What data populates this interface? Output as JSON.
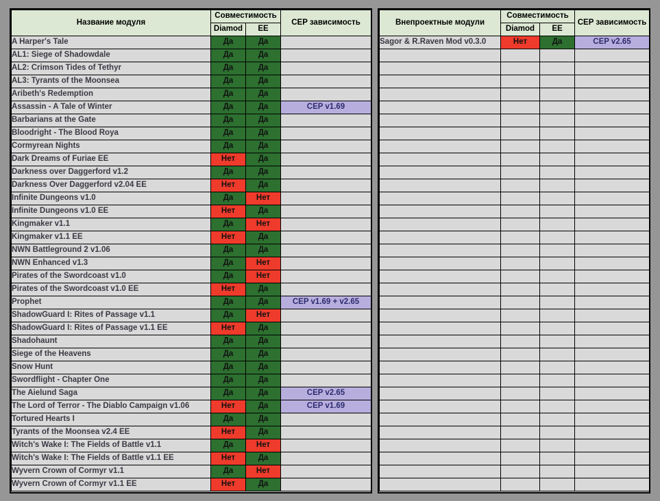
{
  "page": {
    "background_color": "#969696",
    "colors": {
      "header_bg": "#dce8d3",
      "row_bg": "#d9d9d9",
      "yes_bg": "#2d7030",
      "no_bg": "#ee3b2b",
      "dependency_bg": "#b8aede",
      "dependency_text": "#2b2b6e",
      "name_text": "#3a3a44",
      "border": "#000000"
    }
  },
  "left_table": {
    "headers": {
      "name": "Название модуля",
      "compatibility": "Совместимость",
      "diamond": "Diamod",
      "ee": "EE",
      "dependency": "CEP зависимость"
    },
    "values": {
      "yes": "Да",
      "no": "Нет"
    },
    "rows": [
      {
        "name": "A Harper's Tale",
        "diamond": "Да",
        "ee": "Да",
        "dependency": ""
      },
      {
        "name": "AL1: Siege of Shadowdale",
        "diamond": "Да",
        "ee": "Да",
        "dependency": ""
      },
      {
        "name": "AL2: Crimson Tides of Tethyr",
        "diamond": "Да",
        "ee": "Да",
        "dependency": ""
      },
      {
        "name": "AL3: Tyrants of the Moonsea",
        "diamond": "Да",
        "ee": "Да",
        "dependency": ""
      },
      {
        "name": "Aribeth's Redemption",
        "diamond": "Да",
        "ee": "Да",
        "dependency": ""
      },
      {
        "name": "Assassin - A Tale of Winter",
        "diamond": "Да",
        "ee": "Да",
        "dependency": "CEP v1.69"
      },
      {
        "name": "Barbarians at the Gate",
        "diamond": "Да",
        "ee": "Да",
        "dependency": ""
      },
      {
        "name": "Bloodright - The Blood Roya",
        "diamond": "Да",
        "ee": "Да",
        "dependency": ""
      },
      {
        "name": "Cormyrean Nights",
        "diamond": "Да",
        "ee": "Да",
        "dependency": ""
      },
      {
        "name": "Dark Dreams of Furiae EE",
        "diamond": "Нет",
        "ee": "Да",
        "dependency": ""
      },
      {
        "name": "Darkness over Daggerford v1.2",
        "diamond": "Да",
        "ee": "Да",
        "dependency": ""
      },
      {
        "name": "Darkness Over Daggerford v2.04 EE",
        "diamond": "Нет",
        "ee": "Да",
        "dependency": ""
      },
      {
        "name": "Infinite Dungeons v1.0",
        "diamond": "Да",
        "ee": "Нет",
        "dependency": ""
      },
      {
        "name": "Infinite Dungeons v1.0 EE",
        "diamond": "Нет",
        "ee": "Да",
        "dependency": ""
      },
      {
        "name": "Kingmaker v1.1",
        "diamond": "Да",
        "ee": "Нет",
        "dependency": ""
      },
      {
        "name": "Kingmaker v1.1 EE",
        "diamond": "Нет",
        "ee": "Да",
        "dependency": ""
      },
      {
        "name": "NWN Battleground 2 v1.06",
        "diamond": "Да",
        "ee": "Да",
        "dependency": ""
      },
      {
        "name": "NWN Enhanced v1.3",
        "diamond": "Да",
        "ee": "Нет",
        "dependency": ""
      },
      {
        "name": "Pirates of the Swordcoast v1.0",
        "diamond": "Да",
        "ee": "Нет",
        "dependency": ""
      },
      {
        "name": "Pirates of the Swordcoast v1.0 EE",
        "diamond": "Нет",
        "ee": "Да",
        "dependency": ""
      },
      {
        "name": "Prophet",
        "diamond": "Да",
        "ee": "Да",
        "dependency": "CEP v1.69 + v2.65"
      },
      {
        "name": "ShadowGuard I: Rites of Passage v1.1",
        "diamond": "Да",
        "ee": "Нет",
        "dependency": ""
      },
      {
        "name": "ShadowGuard I: Rites of Passage v1.1 EE",
        "diamond": "Нет",
        "ee": "Да",
        "dependency": ""
      },
      {
        "name": "Shadohaunt",
        "diamond": "Да",
        "ee": "Да",
        "dependency": ""
      },
      {
        "name": "Siege of the Heavens",
        "diamond": "Да",
        "ee": "Да",
        "dependency": ""
      },
      {
        "name": "Snow Hunt",
        "diamond": "Да",
        "ee": "Да",
        "dependency": ""
      },
      {
        "name": "Swordflight - Chapter One",
        "diamond": "Да",
        "ee": "Да",
        "dependency": ""
      },
      {
        "name": "The Aielund Saga",
        "diamond": "Да",
        "ee": "Да",
        "dependency": "CEP v2.65"
      },
      {
        "name": "The Lord of Terror - The Diablo Campaign v1.06",
        "diamond": "Нет",
        "ee": "Да",
        "dependency": "CEP v1.69"
      },
      {
        "name": "Tortured Hearts I",
        "diamond": "Да",
        "ee": "Да",
        "dependency": ""
      },
      {
        "name": "Tyrants of the Moonsea v2.4 EE",
        "diamond": "Нет",
        "ee": "Да",
        "dependency": ""
      },
      {
        "name": "Witch's Wake I: The Fields of Battle v1.1",
        "diamond": "Да",
        "ee": "Нет",
        "dependency": ""
      },
      {
        "name": "Witch's Wake I: The Fields of Battle v1.1 EE",
        "diamond": "Нет",
        "ee": "Да",
        "dependency": ""
      },
      {
        "name": "Wyvern Crown of Cormyr v1.1",
        "diamond": "Да",
        "ee": "Нет",
        "dependency": ""
      },
      {
        "name": "Wyvern Crown of Cormyr v1.1 EE",
        "diamond": "Нет",
        "ee": "Да",
        "dependency": ""
      }
    ]
  },
  "right_table": {
    "headers": {
      "name": "Внепроектные модули",
      "compatibility": "Совместимость",
      "diamond": "Diamod",
      "ee": "EE",
      "dependency": "CEP зависимость"
    },
    "rows": [
      {
        "name": "Sagor & R.Raven Mod v0.3.0",
        "diamond": "Нет",
        "ee": "Да",
        "dependency": "CEP v2.65"
      },
      {
        "name": "",
        "diamond": "",
        "ee": "",
        "dependency": ""
      },
      {
        "name": "",
        "diamond": "",
        "ee": "",
        "dependency": ""
      },
      {
        "name": "",
        "diamond": "",
        "ee": "",
        "dependency": ""
      },
      {
        "name": "",
        "diamond": "",
        "ee": "",
        "dependency": ""
      },
      {
        "name": "",
        "diamond": "",
        "ee": "",
        "dependency": ""
      },
      {
        "name": "",
        "diamond": "",
        "ee": "",
        "dependency": ""
      },
      {
        "name": "",
        "diamond": "",
        "ee": "",
        "dependency": ""
      },
      {
        "name": "",
        "diamond": "",
        "ee": "",
        "dependency": ""
      },
      {
        "name": "",
        "diamond": "",
        "ee": "",
        "dependency": ""
      },
      {
        "name": "",
        "diamond": "",
        "ee": "",
        "dependency": ""
      },
      {
        "name": "",
        "diamond": "",
        "ee": "",
        "dependency": ""
      },
      {
        "name": "",
        "diamond": "",
        "ee": "",
        "dependency": ""
      },
      {
        "name": "",
        "diamond": "",
        "ee": "",
        "dependency": ""
      },
      {
        "name": "",
        "diamond": "",
        "ee": "",
        "dependency": ""
      },
      {
        "name": "",
        "diamond": "",
        "ee": "",
        "dependency": ""
      },
      {
        "name": "",
        "diamond": "",
        "ee": "",
        "dependency": ""
      },
      {
        "name": "",
        "diamond": "",
        "ee": "",
        "dependency": ""
      },
      {
        "name": "",
        "diamond": "",
        "ee": "",
        "dependency": ""
      },
      {
        "name": "",
        "diamond": "",
        "ee": "",
        "dependency": ""
      },
      {
        "name": "",
        "diamond": "",
        "ee": "",
        "dependency": ""
      },
      {
        "name": "",
        "diamond": "",
        "ee": "",
        "dependency": ""
      },
      {
        "name": "",
        "diamond": "",
        "ee": "",
        "dependency": ""
      },
      {
        "name": "",
        "diamond": "",
        "ee": "",
        "dependency": ""
      },
      {
        "name": "",
        "diamond": "",
        "ee": "",
        "dependency": ""
      },
      {
        "name": "",
        "diamond": "",
        "ee": "",
        "dependency": ""
      },
      {
        "name": "",
        "diamond": "",
        "ee": "",
        "dependency": ""
      },
      {
        "name": "",
        "diamond": "",
        "ee": "",
        "dependency": ""
      },
      {
        "name": "",
        "diamond": "",
        "ee": "",
        "dependency": ""
      },
      {
        "name": "",
        "diamond": "",
        "ee": "",
        "dependency": ""
      },
      {
        "name": "",
        "diamond": "",
        "ee": "",
        "dependency": ""
      },
      {
        "name": "",
        "diamond": "",
        "ee": "",
        "dependency": ""
      },
      {
        "name": "",
        "diamond": "",
        "ee": "",
        "dependency": ""
      },
      {
        "name": "",
        "diamond": "",
        "ee": "",
        "dependency": ""
      },
      {
        "name": "",
        "diamond": "",
        "ee": "",
        "dependency": ""
      }
    ]
  }
}
